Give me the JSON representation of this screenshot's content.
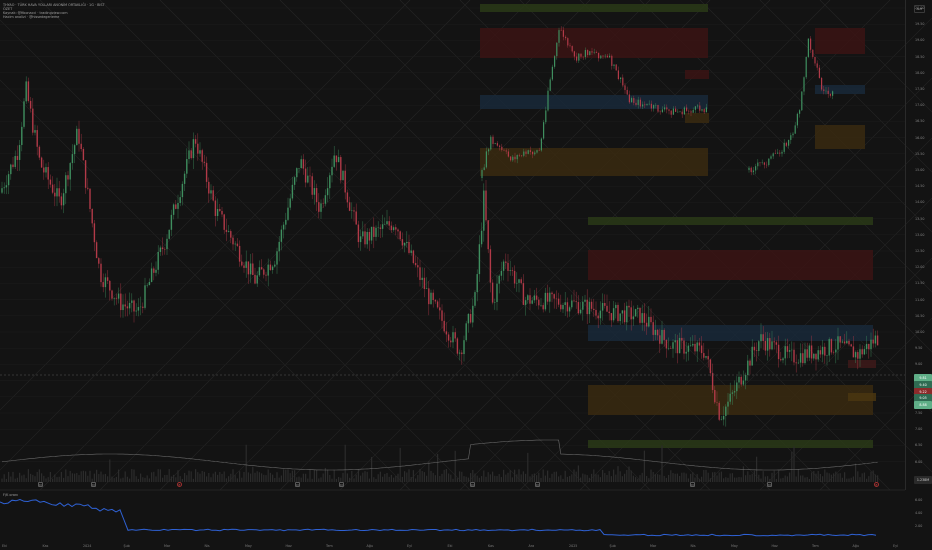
{
  "header": {
    "line1": "THYAO · TÜRK HAVA YOLLARI ANONİM ORTAKLIĞI · 1G · BIST",
    "line2": "ÖZET",
    "line3": "Kaynak: @fibonacci · tradingview.com",
    "line4": "Hacim analizi · @hissedegerleme"
  },
  "price_scale": {
    "labels": [
      "20.00",
      "19.50",
      "19.00",
      "18.50",
      "18.00",
      "17.50",
      "17.00",
      "16.50",
      "16.00",
      "15.50",
      "15.00",
      "14.50",
      "14.00",
      "13.50",
      "13.00",
      "12.50",
      "12.00",
      "11.50",
      "11.00",
      "10.50",
      "10.00",
      "9.50",
      "9.00",
      "8.50",
      "8.00",
      "7.50",
      "7.00",
      "6.50",
      "6.00"
    ],
    "current_price": "9.81",
    "level_tags": [
      {
        "text": "9.81",
        "color": "#5fae87"
      },
      {
        "text": "9.40",
        "color": "#2f6b52"
      },
      {
        "text": "9.22",
        "color": "#8b2a2a"
      },
      {
        "text": "9.05",
        "color": "#2f6b52"
      },
      {
        "text": "8.88",
        "color": "#5fae87"
      }
    ],
    "volume_tag": "1.238M",
    "button": "AUT"
  },
  "time_axis": [
    "Eki",
    "Kas",
    "2024",
    "Şub",
    "Mar",
    "Nis",
    "May",
    "Haz",
    "Tem",
    "Ağu",
    "Eyl",
    "Eki",
    "Kas",
    "Ara",
    "2025",
    "Şub",
    "Mar",
    "Nis",
    "May",
    "Haz",
    "Tem",
    "Ağu",
    "Eyl"
  ],
  "event_markers": [
    {
      "text": "D",
      "color": "gray"
    },
    {
      "text": "D",
      "color": "gray"
    },
    {
      "text": "E",
      "color": "red"
    },
    {
      "text": "D",
      "color": "gray"
    },
    {
      "text": "D",
      "color": "gray"
    },
    {
      "text": "D",
      "color": "gray"
    },
    {
      "text": "D",
      "color": "gray"
    },
    {
      "text": "D",
      "color": "gray"
    },
    {
      "text": "D",
      "color": "gray"
    },
    {
      "text": "E",
      "color": "red"
    }
  ],
  "indicator": {
    "title": "F/K oranı",
    "scale": [
      "6.00",
      "4.00",
      "2.00"
    ]
  },
  "colors": {
    "up": "#3f8f5f",
    "down": "#b23a48",
    "indicator": "#2f62d6",
    "support_zone": "#2a3a18",
    "resistance_zone": "#3b1414",
    "value_zone": "#19293a",
    "amber_zone": "#3a2a10"
  },
  "chart_data": {
    "type": "candlestick",
    "start_price": 14.7,
    "seed": 7
  }
}
